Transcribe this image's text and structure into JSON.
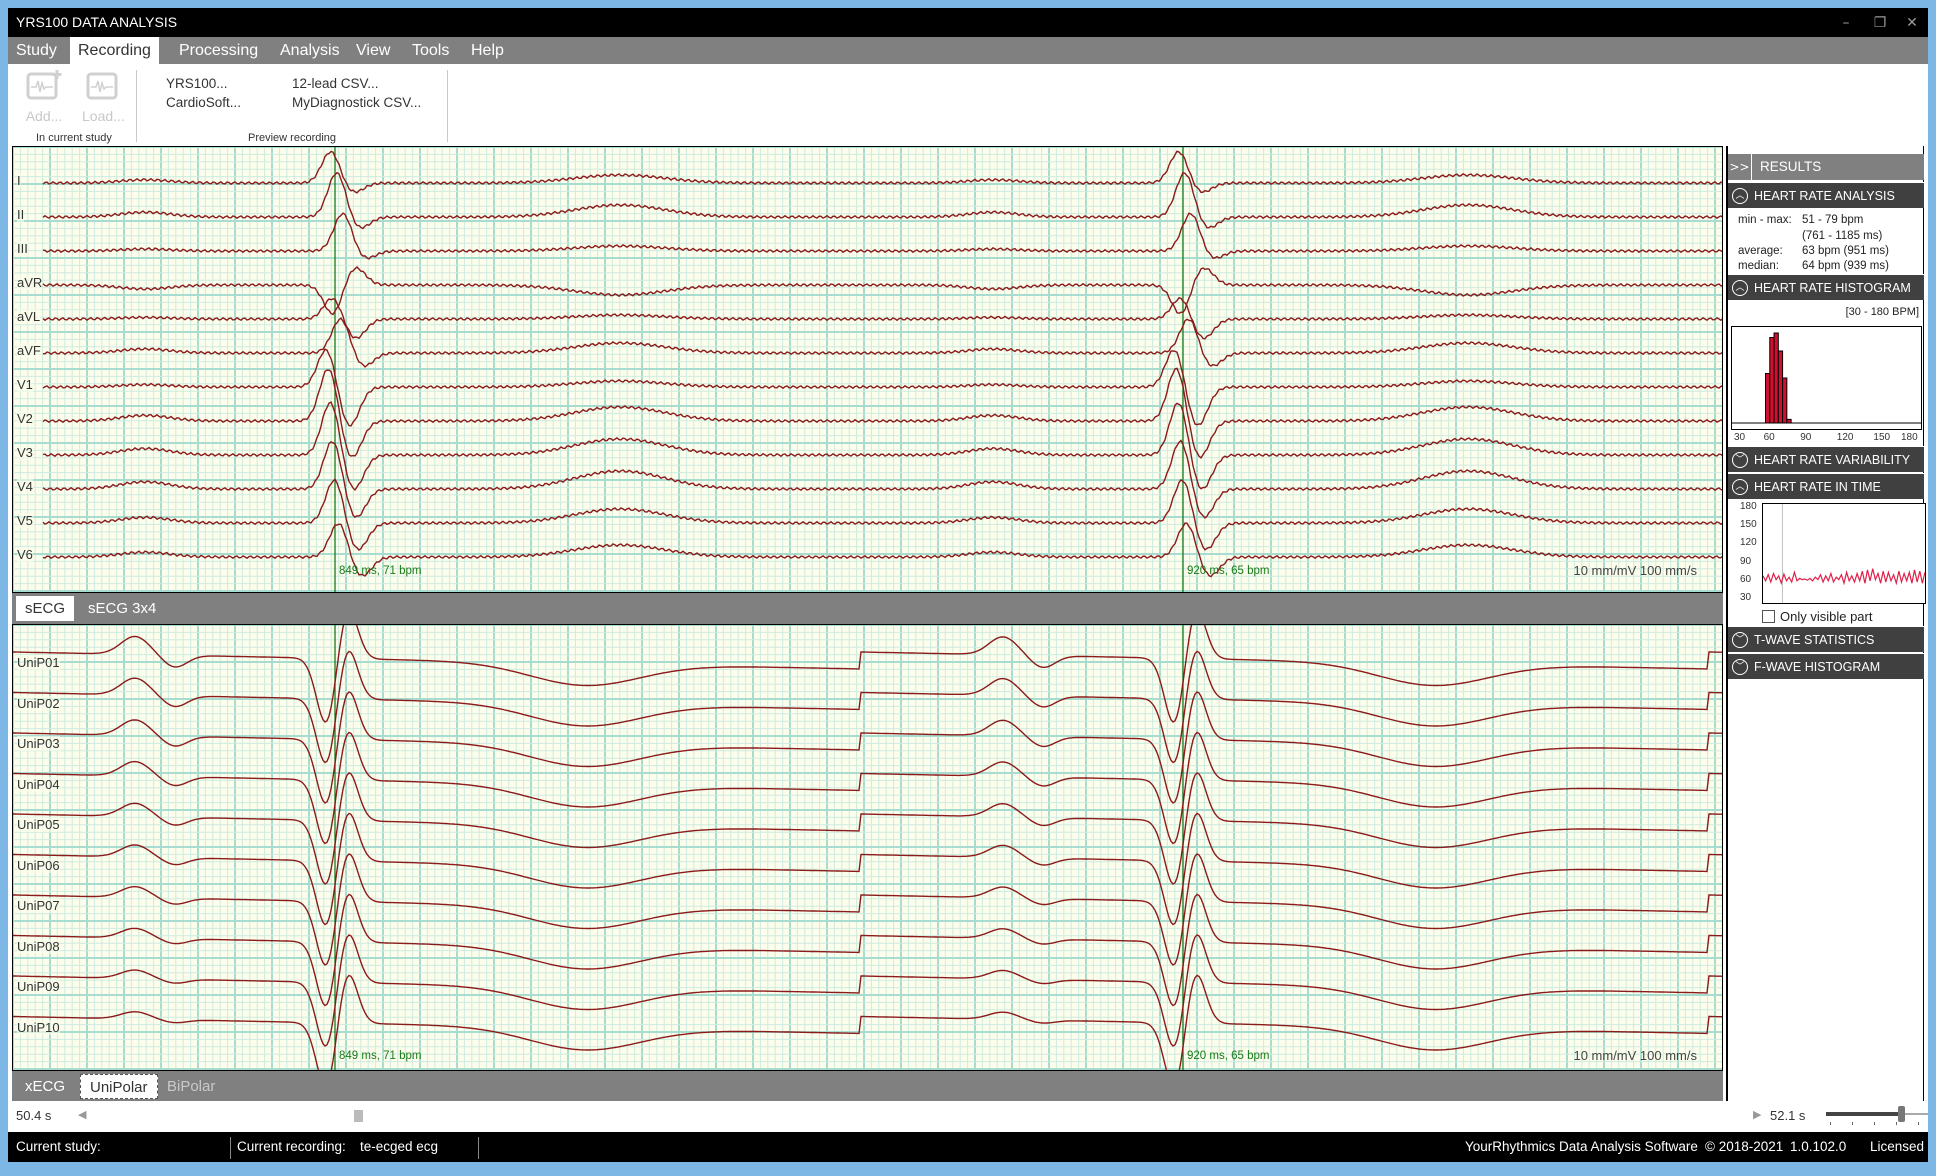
{
  "window": {
    "title": "YRS100 DATA ANALYSIS",
    "controls": {
      "minimize": "–",
      "restore": "❐",
      "close": "✕"
    }
  },
  "menu": {
    "items": [
      "Study",
      "Recording",
      "Processing",
      "Analysis",
      "View",
      "Tools",
      "Help"
    ],
    "active": "Recording"
  },
  "ribbon": {
    "add_label": "Add...",
    "load_label": "Load...",
    "group1_label": "In current study",
    "preview": [
      "YRS100...",
      "CardioSoft...",
      "12-lead CSV...",
      "MyDiagnostick CSV..."
    ],
    "group2_label": "Preview recording"
  },
  "secg_panel": {
    "leads": [
      "I",
      "II",
      "III",
      "aVR",
      "aVL",
      "aVF",
      "V1",
      "V2",
      "V3",
      "V4",
      "V5",
      "V6"
    ],
    "markers": [
      {
        "label": "849 ms, 71 bpm"
      },
      {
        "label": "920 ms, 65 bpm"
      }
    ],
    "scale": "10 mm/mV  100 mm/s",
    "tabs": [
      "sECG",
      "sECG 3x4"
    ],
    "active_tab": "sECG"
  },
  "xecg_panel": {
    "leads": [
      "UniP01",
      "UniP02",
      "UniP03",
      "UniP04",
      "UniP05",
      "UniP06",
      "UniP07",
      "UniP08",
      "UniP09",
      "UniP10"
    ],
    "markers": [
      {
        "label": "849 ms, 71 bpm"
      },
      {
        "label": "920 ms, 65 bpm"
      }
    ],
    "scale": "10 mm/mV  100 mm/s",
    "tabs": [
      "xECG",
      "UniPolar",
      "BiPolar"
    ],
    "active_tab": "UniPolar"
  },
  "timeline": {
    "start": "50.4 s",
    "end": "52.1 s",
    "zoom_slider_fraction": 0.8
  },
  "status": {
    "current_study_label": "Current study:",
    "current_study_value": "",
    "current_recording_label": "Current recording:",
    "current_recording_value": "te-ecged ecg",
    "product": "YourRhythmics Data Analysis Software",
    "copyright": "© 2018-2021",
    "version": "1.0.102.0",
    "license": "Licensed"
  },
  "results": {
    "toggle": ">>",
    "title": "RESULTS",
    "sections": {
      "hr_analysis": {
        "title": "HEART RATE ANALYSIS",
        "expanded": true,
        "rows": [
          {
            "label": "min - max:",
            "value": "51 - 79 bpm"
          },
          {
            "label": "",
            "value": "(761 - 1185 ms)"
          },
          {
            "label": "average:",
            "value": "63 bpm (951 ms)"
          },
          {
            "label": "median:",
            "value": "64 bpm (939 ms)"
          }
        ]
      },
      "hr_histogram": {
        "title": "HEART RATE HISTOGRAM",
        "expanded": true,
        "range_label": "[30 - 180 BPM]"
      },
      "hr_variability": {
        "title": "HEART RATE VARIABILITY",
        "expanded": false
      },
      "hr_in_time": {
        "title": "HEART RATE IN TIME",
        "expanded": true,
        "only_visible_label": "Only visible part",
        "only_visible_checked": false
      },
      "t_wave": {
        "title": "T-WAVE STATISTICS",
        "expanded": false
      },
      "f_wave": {
        "title": "F-WAVE HISTOGRAM",
        "expanded": false
      }
    }
  },
  "chart_data": [
    {
      "type": "bar",
      "title": "HEART RATE HISTOGRAM",
      "subtitle": "[30 - 180 BPM]",
      "xlabel": "bpm",
      "xlim": [
        30,
        180
      ],
      "xticks": [
        30,
        60,
        90,
        120,
        150,
        180
      ],
      "bins": [
        {
          "from": 55,
          "to": 58.5,
          "rel": 0.55
        },
        {
          "from": 58.5,
          "to": 62,
          "rel": 0.95
        },
        {
          "from": 62,
          "to": 65.5,
          "rel": 1.0
        },
        {
          "from": 65.5,
          "to": 69,
          "rel": 0.8
        },
        {
          "from": 69,
          "to": 72.5,
          "rel": 0.5
        },
        {
          "from": 72.5,
          "to": 76,
          "rel": 0.04
        }
      ],
      "bar_color": "#d01030"
    },
    {
      "type": "line",
      "title": "HEART RATE IN TIME",
      "ylim": [
        30,
        180
      ],
      "yticks": [
        180,
        150,
        120,
        90,
        60,
        30
      ],
      "cursor_fraction": 0.12,
      "series": [
        {
          "name": "heart rate",
          "color": "#e0204a",
          "values": [
            68,
            60,
            70,
            58,
            72,
            62,
            68,
            56,
            71,
            60,
            66,
            58,
            74,
            60,
            64,
            62,
            63,
            61,
            64,
            60,
            66,
            62,
            70,
            58,
            68,
            60,
            72,
            58,
            66,
            62,
            70,
            56,
            74,
            60,
            68,
            58,
            72,
            60,
            76,
            56,
            78,
            60,
            80,
            62,
            72,
            56,
            76,
            58,
            74,
            60,
            70,
            56,
            76,
            58,
            72,
            60,
            74,
            56,
            78,
            58,
            76,
            56,
            74
          ]
        }
      ]
    }
  ],
  "colors": {
    "trace": "#8b1a1a",
    "grid_major": "#a8dcd0",
    "grid_minor": "#cdebe0",
    "grid_bg": "#fdfdec",
    "marker": "#1a7a1a",
    "histogram_bar": "#d01030"
  }
}
